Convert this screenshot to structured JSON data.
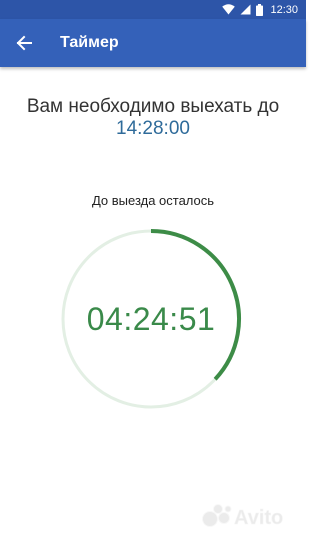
{
  "status_bar": {
    "time": "12:30",
    "icons": [
      "wifi-icon",
      "signal-icon",
      "battery-icon"
    ]
  },
  "app_bar": {
    "title": "Таймер",
    "back_icon": "arrow-left-icon",
    "background": "#3461b9"
  },
  "main": {
    "headline": "Вам необходимо выехать до",
    "deadline_time": "14:28:00",
    "remaining_label": "До выезда осталось",
    "timer_value": "04:24:51",
    "progress_fraction": 0.37,
    "progress_color": "#3d8c47",
    "track_color": "#e3efe4"
  },
  "watermark": {
    "text": "Avito"
  }
}
